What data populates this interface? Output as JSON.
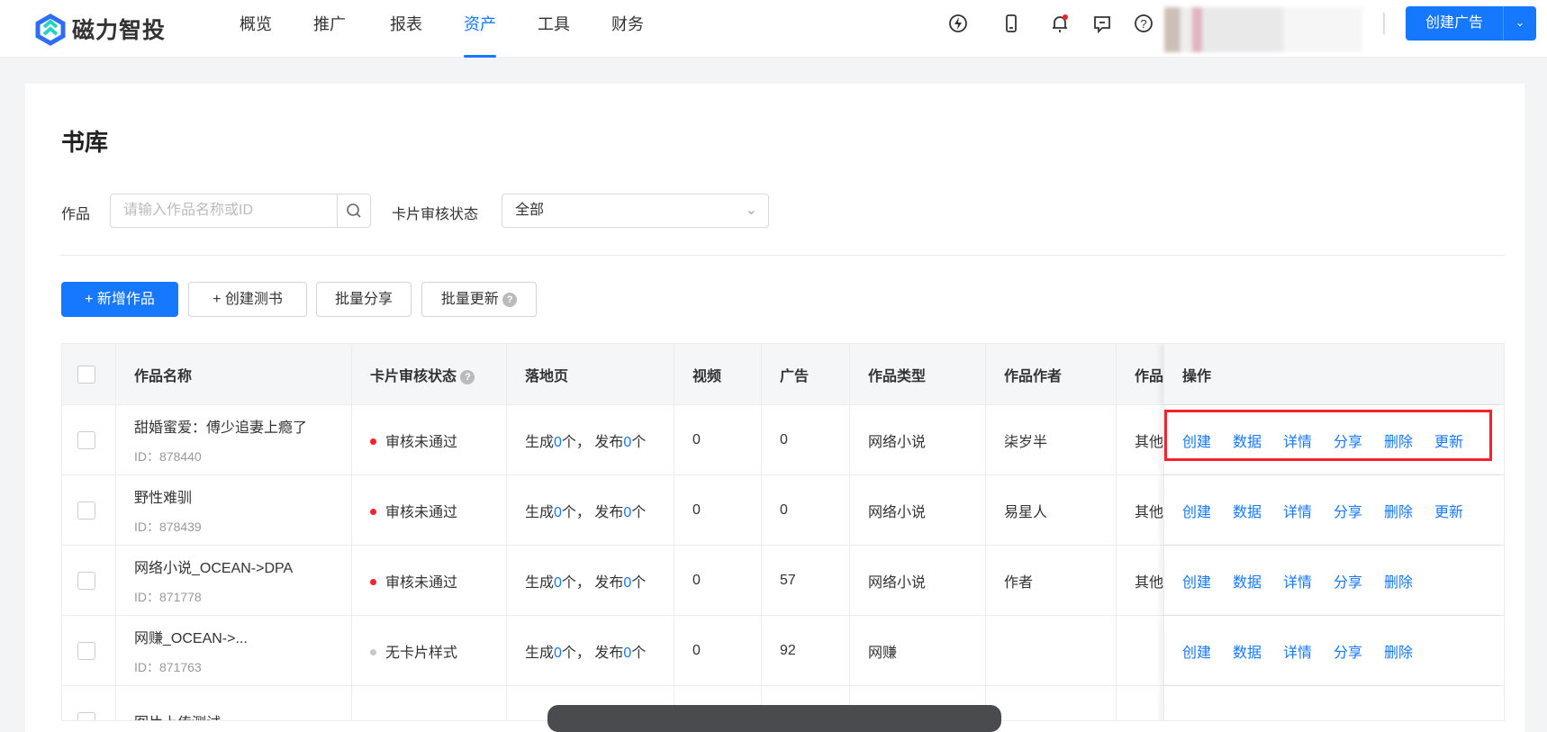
{
  "header": {
    "brand": "磁力智投",
    "nav": [
      "概览",
      "推广",
      "报表",
      "资产",
      "工具",
      "财务"
    ],
    "active_nav": "资产",
    "create_button": "创建广告",
    "icons": [
      "flash-icon",
      "mobile-icon",
      "bell-icon",
      "message-icon",
      "help-icon"
    ]
  },
  "page": {
    "title": "书库"
  },
  "filters": {
    "work_label": "作品",
    "work_placeholder": "请输入作品名称或ID",
    "status_label": "卡片审核状态",
    "status_value": "全部"
  },
  "actions": {
    "add": "+ 新增作品",
    "create_test": "+ 创建测书",
    "batch_share": "批量分享",
    "batch_update": "批量更新"
  },
  "table": {
    "columns": [
      "作品名称",
      "卡片审核状态",
      "落地页",
      "视频",
      "广告",
      "作品类型",
      "作品作者",
      "作品",
      "操作"
    ],
    "rows": [
      {
        "name": "甜婚蜜爱：傅少追妻上瘾了",
        "id": "ID：878440",
        "status": "审核未通过",
        "status_color": "#f5222d",
        "gen_pre": "生成",
        "gen": "0",
        "gen_suf": "个，",
        "pub_pre": "发布",
        "pub": "0",
        "pub_suf": "个",
        "video": "0",
        "ads": "0",
        "type": "网络小说",
        "author": "柒岁半",
        "other": "其他",
        "ops": [
          "创建",
          "数据",
          "详情",
          "分享",
          "删除",
          "更新"
        ]
      },
      {
        "name": "野性难驯",
        "id": "ID：878439",
        "status": "审核未通过",
        "status_color": "#f5222d",
        "gen_pre": "生成",
        "gen": "0",
        "gen_suf": "个，",
        "pub_pre": "发布",
        "pub": "0",
        "pub_suf": "个",
        "video": "0",
        "ads": "0",
        "type": "网络小说",
        "author": "易星人",
        "other": "其他",
        "ops": [
          "创建",
          "数据",
          "详情",
          "分享",
          "删除",
          "更新"
        ]
      },
      {
        "name": "网络小说_OCEAN->DPA",
        "id": "ID：871778",
        "status": "审核未通过",
        "status_color": "#f5222d",
        "gen_pre": "生成",
        "gen": "0",
        "gen_suf": "个，",
        "pub_pre": "发布",
        "pub": "0",
        "pub_suf": "个",
        "video": "0",
        "ads": "57",
        "type": "网络小说",
        "author": "作者",
        "other": "其他",
        "ops": [
          "创建",
          "数据",
          "详情",
          "分享",
          "删除"
        ]
      },
      {
        "name": "网赚_OCEAN->...",
        "id": "ID：871763",
        "status": "无卡片样式",
        "status_color": "#c8c8c8",
        "gen_pre": "生成",
        "gen": "0",
        "gen_suf": "个，",
        "pub_pre": "发布",
        "pub": "0",
        "pub_suf": "个",
        "video": "0",
        "ads": "92",
        "type": "网赚",
        "author": "",
        "other": "",
        "ops": [
          "创建",
          "数据",
          "详情",
          "分享",
          "删除"
        ]
      },
      {
        "name": "图片上传测试"
      }
    ]
  }
}
